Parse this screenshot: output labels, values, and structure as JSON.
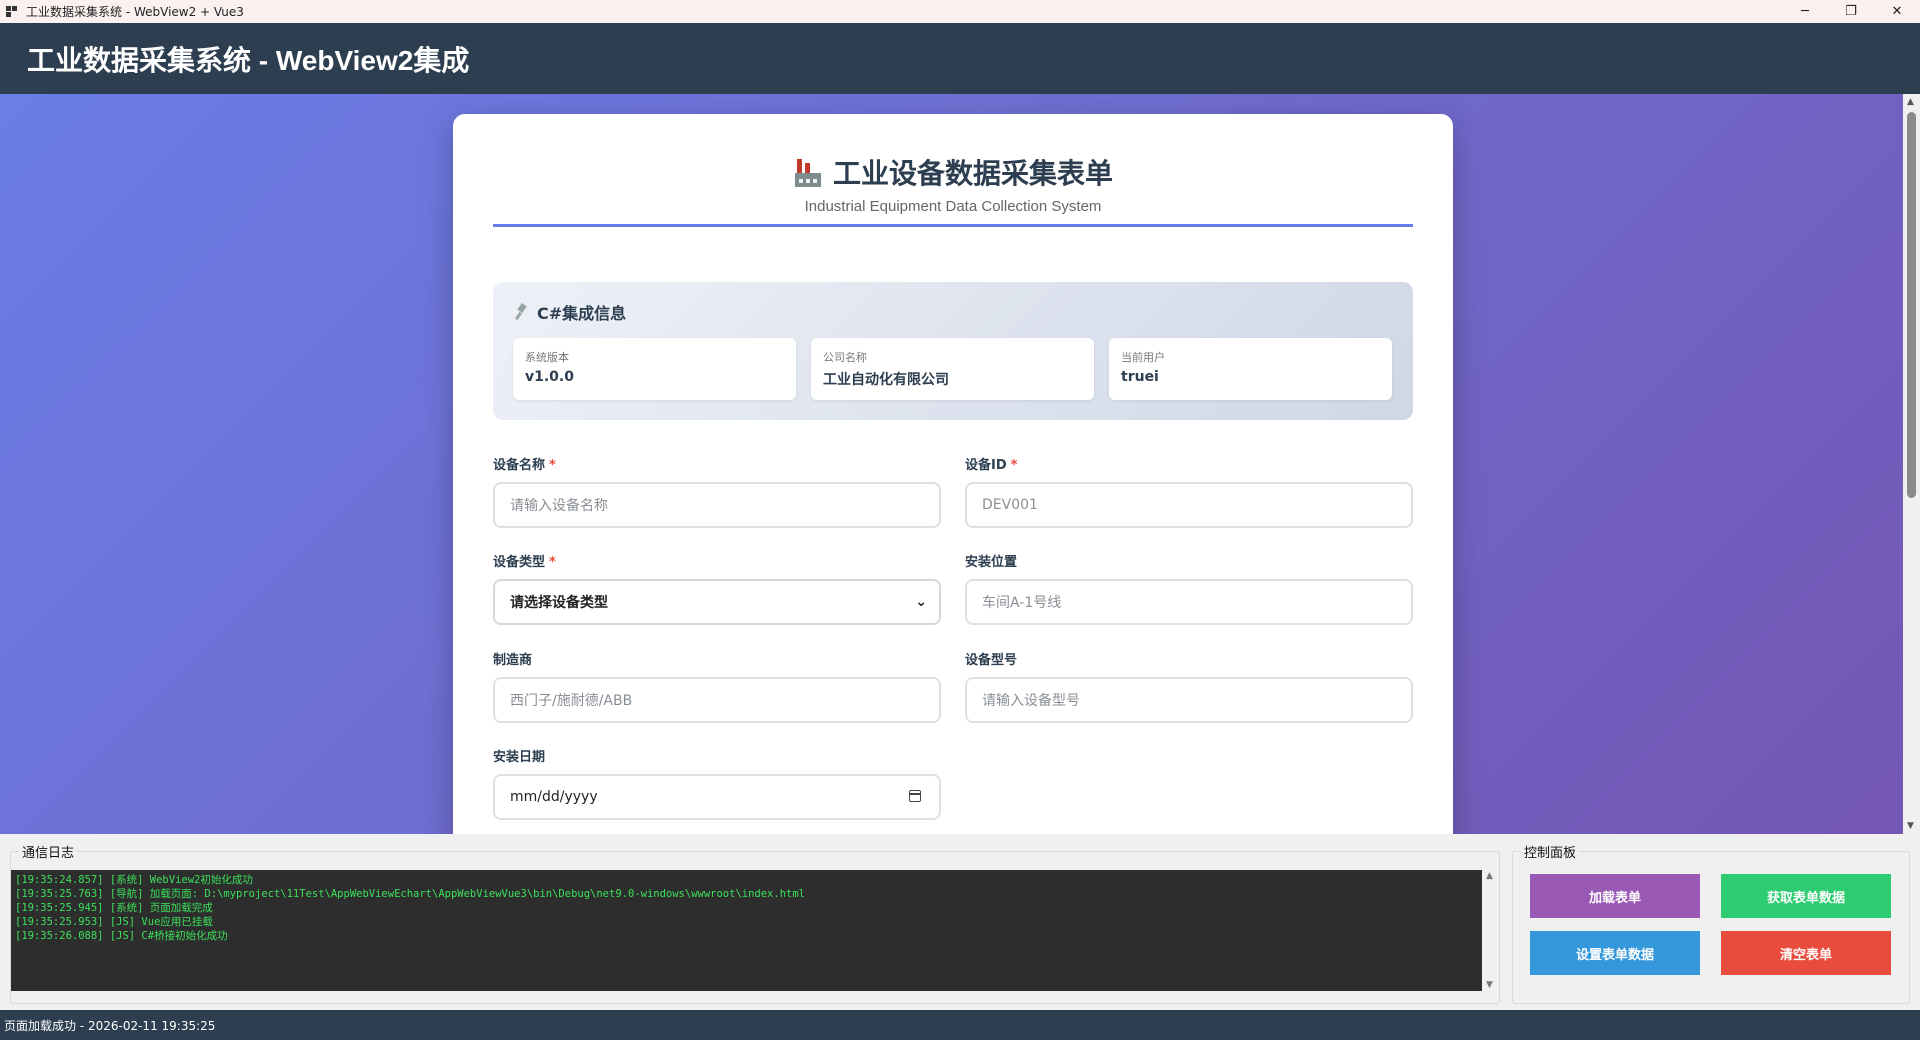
{
  "window": {
    "title": "工业数据采集系统 - WebView2 + Vue3",
    "minimize": "─",
    "maximize": "❐",
    "close": "✕"
  },
  "header": {
    "title": "工业数据采集系统 - WebView2集成"
  },
  "form": {
    "title": "工业设备数据采集表单",
    "subtitle": "Industrial Equipment Data Collection System",
    "info": {
      "heading": "C#集成信息",
      "items": [
        {
          "label": "系统版本",
          "value": "v1.0.0"
        },
        {
          "label": "公司名称",
          "value": "工业自动化有限公司"
        },
        {
          "label": "当前用户",
          "value": "truei"
        }
      ]
    },
    "fields": {
      "device_name": {
        "label": "设备名称",
        "required": "*",
        "placeholder": "请输入设备名称"
      },
      "device_id": {
        "label": "设备ID",
        "required": "*",
        "placeholder": "DEV001"
      },
      "device_type": {
        "label": "设备类型",
        "required": "*",
        "selected": "请选择设备类型"
      },
      "location": {
        "label": "安装位置",
        "placeholder": "车间A-1号线"
      },
      "manufacturer": {
        "label": "制造商",
        "placeholder": "西门子/施耐德/ABB"
      },
      "model": {
        "label": "设备型号",
        "placeholder": "请输入设备型号"
      },
      "install_date": {
        "label": "安装日期",
        "placeholder": "mm/dd/yyyy"
      }
    }
  },
  "log": {
    "legend": "通信日志",
    "lines": [
      "[19:35:24.857] [系统] WebView2初始化成功",
      "[19:35:25.763] [导航] 加载页面: D:\\myproject\\11Test\\AppWebViewEchart\\AppWebViewVue3\\bin\\Debug\\net9.0-windows\\wwwroot\\index.html",
      "[19:35:25.945] [系统] 页面加载完成",
      "[19:35:25.953] [JS] Vue应用已挂载",
      "[19:35:26.088] [JS] C#桥接初始化成功"
    ]
  },
  "control": {
    "legend": "控制面板",
    "buttons": {
      "load": {
        "label": "加载表单",
        "color": "#9b59b6"
      },
      "get": {
        "label": "获取表单数据",
        "color": "#2ecc71"
      },
      "set": {
        "label": "设置表单数据",
        "color": "#3498db"
      },
      "clear": {
        "label": "清空表单",
        "color": "#e74c3c"
      }
    }
  },
  "status": {
    "text": "页面加载成功 - 2026-02-11 19:35:25"
  }
}
